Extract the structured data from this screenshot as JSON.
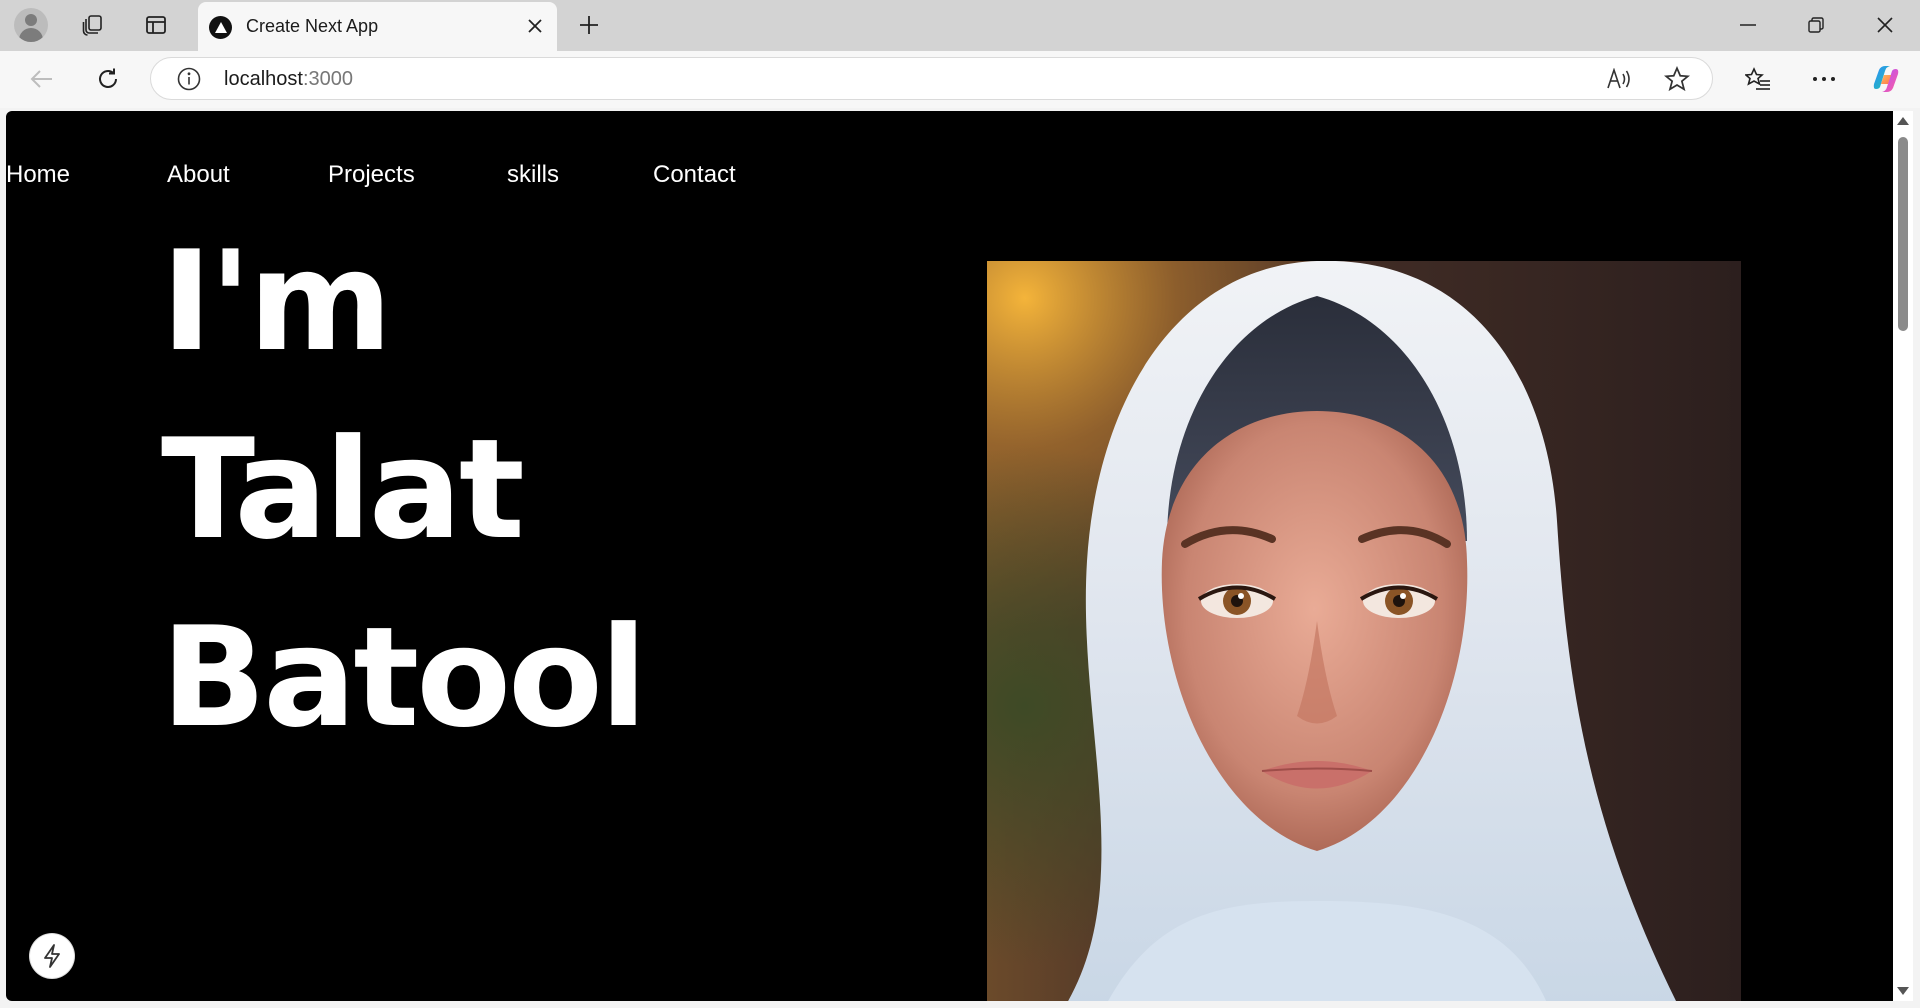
{
  "browser": {
    "tab": {
      "title": "Create Next App"
    },
    "address": {
      "host": "localhost",
      "port": ":3000"
    },
    "icons": {
      "profile": "profile-avatar-icon",
      "workspaces": "workspaces-icon",
      "vertical_tabs": "vertical-tabs-icon",
      "favicon": "nextjs-triangle-icon",
      "close_tab": "close-icon",
      "new_tab": "plus-icon",
      "minimize": "minimize-icon",
      "restore": "restore-icon",
      "close_window": "close-icon",
      "back": "back-arrow-icon",
      "refresh": "refresh-icon",
      "site_info": "info-icon",
      "read_aloud": "read-aloud-icon",
      "favorite": "star-icon",
      "favorites": "favorites-list-icon",
      "more": "more-dots-icon",
      "copilot": "copilot-icon"
    }
  },
  "page": {
    "nav": [
      "Home",
      "About",
      "Projects",
      "skills",
      "Contact"
    ],
    "hero": {
      "line1": "I'm",
      "line2": "Talat",
      "line3": "Batool"
    },
    "portrait": {
      "subject": "illustrated-woman-in-white-hijab"
    },
    "colors": {
      "background": "#000000",
      "text": "#ffffff"
    },
    "dev_indicator_icon": "lightning-bolt-icon"
  }
}
